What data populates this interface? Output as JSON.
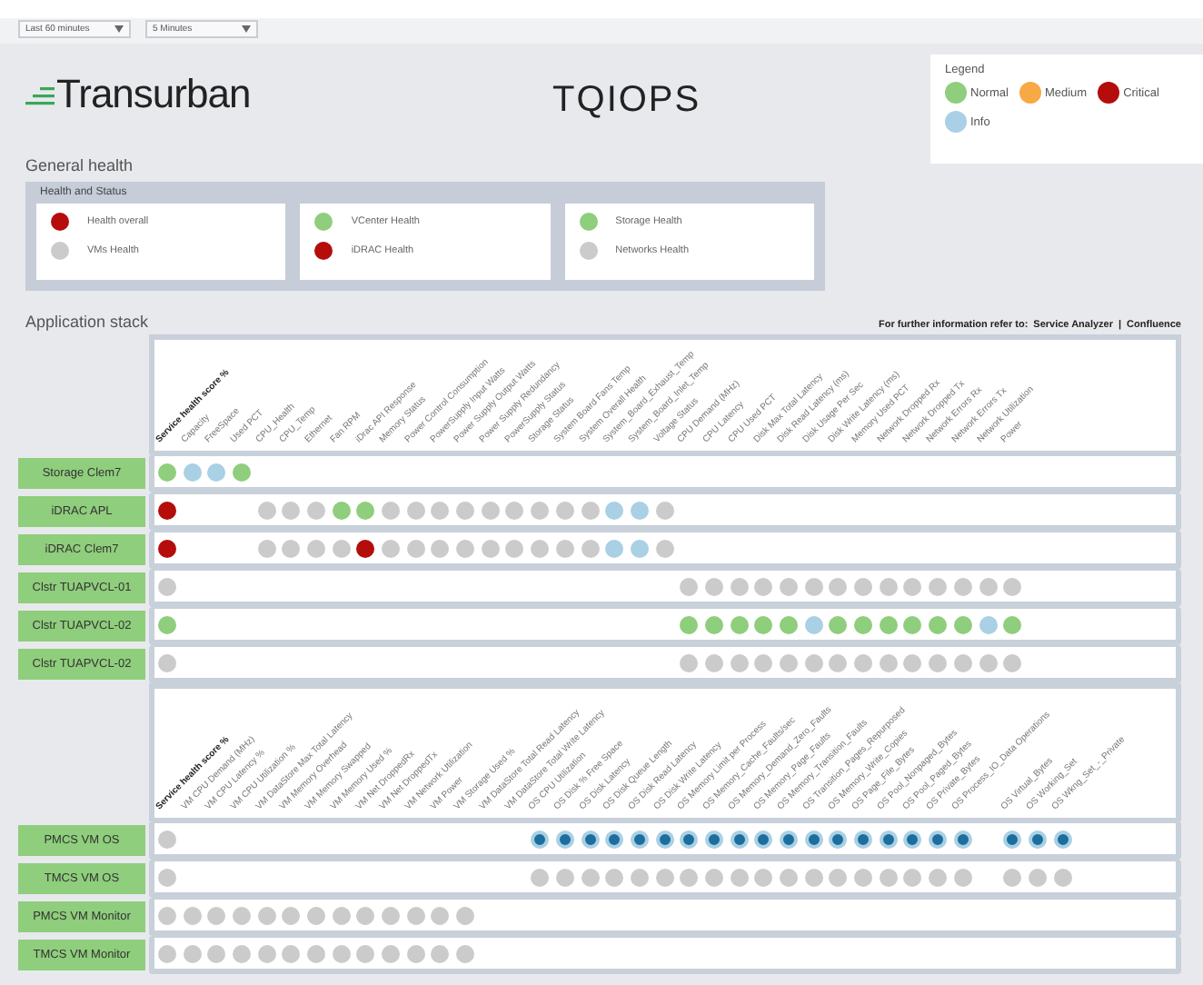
{
  "filters": [
    {
      "value": "Last 60 minutes"
    },
    {
      "value": "5 Minutes"
    }
  ],
  "header": {
    "logo": "Transurban",
    "title": "TQIOPS"
  },
  "legend": {
    "title": "Legend",
    "items": [
      {
        "label": "Normal",
        "color": "#8fce7c"
      },
      {
        "label": "Medium",
        "color": "#f6a945"
      },
      {
        "label": "Critical",
        "color": "#b50c0c"
      },
      {
        "label": "Info",
        "color": "#a9d0e4"
      }
    ]
  },
  "general_health": {
    "title": "General health",
    "panel_title": "Health and Status",
    "cards": [
      {
        "items": [
          {
            "label": "Health overall",
            "color": "#b50c0c"
          },
          {
            "label": "VMs Health",
            "color": "#cbcbcb"
          }
        ]
      },
      {
        "items": [
          {
            "label": "VCenter Health",
            "color": "#8fce7c"
          },
          {
            "label": "iDRAC Health",
            "color": "#b50c0c"
          }
        ]
      },
      {
        "items": [
          {
            "label": "Storage Health",
            "color": "#8fce7c"
          },
          {
            "label": "Networks Health",
            "color": "#cbcbcb"
          }
        ]
      }
    ]
  },
  "application_stack": {
    "title": "Application stack",
    "info_text": "For further information refer to:",
    "links": [
      "Service Analyzer",
      "Confluence"
    ],
    "separator": "|",
    "panels": [
      {
        "columns": [
          "Service health score %",
          "Capacity",
          "FreeSpace",
          "Used PCT",
          "CPU_Health",
          "CPU_Temp",
          "Ethernet",
          "Fan RPM",
          "iDrac API Response",
          "Memory Status",
          "Power Control Consumption",
          "PowerSupply Input Watts",
          "Power Supply Output Watts",
          "Power Supply Redundancy",
          "PowerSupply Status",
          "Storage Status",
          "System Board Fans Temp",
          "System Overall Health",
          "System_Board_Exhaust_Temp",
          "System_Board_Inlet_Temp",
          "Voltage Status",
          "CPU Demand (MHz)",
          "CPU Latency",
          "CPU Used PCT",
          "Disk Max Total Latency",
          "Disk Read Latency (ms)",
          "Disk Usage Per Sec",
          "Disk Write Latency (ms)",
          "Memory Used PCT",
          "Network Dropped Rx",
          "Network Dropped Tx",
          "Network Errors Rx",
          "Network Errors Tx",
          "Network Utilization",
          "Power"
        ],
        "rows": [
          {
            "label": "Storage Clem7",
            "cells": [
              {
                "color": "#8fce7c"
              },
              {
                "color": "#a9d0e4"
              },
              {
                "color": "#a9d0e4"
              },
              {
                "color": "#8fce7c"
              },
              null,
              null,
              null,
              null,
              null,
              null,
              null,
              null,
              null,
              null,
              null,
              null,
              null,
              null,
              null,
              null,
              null,
              null,
              null,
              null,
              null,
              null,
              null,
              null,
              null,
              null,
              null,
              null,
              null,
              null,
              null
            ]
          },
          {
            "label": "iDRAC APL",
            "cells": [
              {
                "color": "#b50c0c"
              },
              null,
              null,
              null,
              {
                "color": "#cbcbcb"
              },
              {
                "color": "#cbcbcb"
              },
              {
                "color": "#cbcbcb"
              },
              {
                "color": "#8fce7c"
              },
              {
                "color": "#8fce7c"
              },
              {
                "color": "#cbcbcb"
              },
              {
                "color": "#cbcbcb"
              },
              {
                "color": "#cbcbcb"
              },
              {
                "color": "#cbcbcb"
              },
              {
                "color": "#cbcbcb"
              },
              {
                "color": "#cbcbcb"
              },
              {
                "color": "#cbcbcb"
              },
              {
                "color": "#cbcbcb"
              },
              {
                "color": "#cbcbcb"
              },
              {
                "color": "#a9d0e4"
              },
              {
                "color": "#a9d0e4"
              },
              {
                "color": "#cbcbcb"
              },
              null,
              null,
              null,
              null,
              null,
              null,
              null,
              null,
              null,
              null,
              null,
              null,
              null,
              null
            ]
          },
          {
            "label": "iDRAC Clem7",
            "cells": [
              {
                "color": "#b50c0c"
              },
              null,
              null,
              null,
              {
                "color": "#cbcbcb"
              },
              {
                "color": "#cbcbcb"
              },
              {
                "color": "#cbcbcb"
              },
              {
                "color": "#cbcbcb"
              },
              {
                "color": "#b50c0c"
              },
              {
                "color": "#cbcbcb"
              },
              {
                "color": "#cbcbcb"
              },
              {
                "color": "#cbcbcb"
              },
              {
                "color": "#cbcbcb"
              },
              {
                "color": "#cbcbcb"
              },
              {
                "color": "#cbcbcb"
              },
              {
                "color": "#cbcbcb"
              },
              {
                "color": "#cbcbcb"
              },
              {
                "color": "#cbcbcb"
              },
              {
                "color": "#a9d0e4"
              },
              {
                "color": "#a9d0e4"
              },
              {
                "color": "#cbcbcb"
              },
              null,
              null,
              null,
              null,
              null,
              null,
              null,
              null,
              null,
              null,
              null,
              null,
              null,
              null
            ]
          },
          {
            "label": "Clstr TUAPVCL-01",
            "cells": [
              {
                "color": "#cbcbcb"
              },
              null,
              null,
              null,
              null,
              null,
              null,
              null,
              null,
              null,
              null,
              null,
              null,
              null,
              null,
              null,
              null,
              null,
              null,
              null,
              null,
              {
                "color": "#cbcbcb"
              },
              {
                "color": "#cbcbcb"
              },
              {
                "color": "#cbcbcb"
              },
              {
                "color": "#cbcbcb"
              },
              {
                "color": "#cbcbcb"
              },
              {
                "color": "#cbcbcb"
              },
              {
                "color": "#cbcbcb"
              },
              {
                "color": "#cbcbcb"
              },
              {
                "color": "#cbcbcb"
              },
              {
                "color": "#cbcbcb"
              },
              {
                "color": "#cbcbcb"
              },
              {
                "color": "#cbcbcb"
              },
              {
                "color": "#cbcbcb"
              },
              {
                "color": "#cbcbcb"
              }
            ]
          },
          {
            "label": "Clstr TUAPVCL-02",
            "cells": [
              {
                "color": "#8fce7c"
              },
              null,
              null,
              null,
              null,
              null,
              null,
              null,
              null,
              null,
              null,
              null,
              null,
              null,
              null,
              null,
              null,
              null,
              null,
              null,
              null,
              {
                "color": "#8fce7c"
              },
              {
                "color": "#8fce7c"
              },
              {
                "color": "#8fce7c"
              },
              {
                "color": "#8fce7c"
              },
              {
                "color": "#8fce7c"
              },
              {
                "color": "#a9d0e4"
              },
              {
                "color": "#8fce7c"
              },
              {
                "color": "#8fce7c"
              },
              {
                "color": "#8fce7c"
              },
              {
                "color": "#8fce7c"
              },
              {
                "color": "#8fce7c"
              },
              {
                "color": "#8fce7c"
              },
              {
                "color": "#a9d0e4"
              },
              {
                "color": "#8fce7c"
              }
            ]
          },
          {
            "label": "Clstr TUAPVCL-02",
            "cells": [
              {
                "color": "#cbcbcb"
              },
              null,
              null,
              null,
              null,
              null,
              null,
              null,
              null,
              null,
              null,
              null,
              null,
              null,
              null,
              null,
              null,
              null,
              null,
              null,
              null,
              {
                "color": "#cbcbcb"
              },
              {
                "color": "#cbcbcb"
              },
              {
                "color": "#cbcbcb"
              },
              {
                "color": "#cbcbcb"
              },
              {
                "color": "#cbcbcb"
              },
              {
                "color": "#cbcbcb"
              },
              {
                "color": "#cbcbcb"
              },
              {
                "color": "#cbcbcb"
              },
              {
                "color": "#cbcbcb"
              },
              {
                "color": "#cbcbcb"
              },
              {
                "color": "#cbcbcb"
              },
              {
                "color": "#cbcbcb"
              },
              {
                "color": "#cbcbcb"
              },
              {
                "color": "#cbcbcb"
              }
            ]
          }
        ]
      },
      {
        "columns": [
          "Service health score %",
          "VM CPU Demand (MHz)",
          "VM CPU Latency %",
          "VM CPU Utilization %",
          "VM DataStore Max Total Latency",
          "VM Memory Overhead",
          "VM Memory Swapped",
          "VM Memory Used %",
          "VM Net DroppedRx",
          "VM Net DroppedTx",
          "VM Network Utilization",
          "VM Power",
          "VM Storage Used %",
          "VM DataStore Total Read Latency",
          "VM DataStore Total Write Latency",
          "OS CPU Utilization",
          "OS Disk % Free Space",
          "OS Disk Latency",
          "OS Disk Queue Length",
          "OS Disk Read Latency",
          "OS Disk Write Latency",
          "OS Memory Limit per Process",
          "OS Memory_Cache_Faults/sec",
          "OS Memory_Demand_Zero_Faults",
          "OS Memory_Page_Faults",
          "OS Memory_Transition_Faults",
          "OS Transition_Pages_Repurposed",
          "OS Memory_Write_Copies",
          "OS Page_File_Bytes",
          "OS Pool_Nonpaged_Bytes",
          "OS Pool_Paged_Bytes",
          "OS Private_Bytes",
          "OS Process_IO_Data Operations",
          null,
          "OS Virtual_Bytes",
          "OS Working_Set",
          "OS Wkng_Set_-_Private"
        ],
        "rows": [
          {
            "label": "PMCS VM OS",
            "cells": [
              {
                "color": "#cbcbcb"
              },
              null,
              null,
              null,
              null,
              null,
              null,
              null,
              null,
              null,
              null,
              null,
              null,
              null,
              null,
              {
                "color": "#1c6e9e",
                "kind": "ringed"
              },
              {
                "color": "#1c6e9e",
                "kind": "ringed"
              },
              {
                "color": "#1c6e9e",
                "kind": "ringed"
              },
              {
                "color": "#1c6e9e",
                "kind": "ringed"
              },
              {
                "color": "#1c6e9e",
                "kind": "ringed"
              },
              {
                "color": "#1c6e9e",
                "kind": "ringed"
              },
              {
                "color": "#1c6e9e",
                "kind": "ringed"
              },
              {
                "color": "#1c6e9e",
                "kind": "ringed"
              },
              {
                "color": "#1c6e9e",
                "kind": "ringed"
              },
              {
                "color": "#1c6e9e",
                "kind": "ringed"
              },
              {
                "color": "#1c6e9e",
                "kind": "ringed"
              },
              {
                "color": "#1c6e9e",
                "kind": "ringed"
              },
              {
                "color": "#1c6e9e",
                "kind": "ringed"
              },
              {
                "color": "#1c6e9e",
                "kind": "ringed"
              },
              {
                "color": "#1c6e9e",
                "kind": "ringed"
              },
              {
                "color": "#1c6e9e",
                "kind": "ringed"
              },
              {
                "color": "#1c6e9e",
                "kind": "ringed"
              },
              {
                "color": "#1c6e9e",
                "kind": "ringed"
              },
              null,
              {
                "color": "#1c6e9e",
                "kind": "ringed"
              },
              {
                "color": "#1c6e9e",
                "kind": "ringed"
              },
              {
                "color": "#1c6e9e",
                "kind": "ringed"
              }
            ]
          },
          {
            "label": "TMCS VM OS",
            "cells": [
              {
                "color": "#cbcbcb"
              },
              null,
              null,
              null,
              null,
              null,
              null,
              null,
              null,
              null,
              null,
              null,
              null,
              null,
              null,
              {
                "color": "#cbcbcb"
              },
              {
                "color": "#cbcbcb"
              },
              {
                "color": "#cbcbcb"
              },
              {
                "color": "#cbcbcb"
              },
              {
                "color": "#cbcbcb"
              },
              {
                "color": "#cbcbcb"
              },
              {
                "color": "#cbcbcb"
              },
              {
                "color": "#cbcbcb"
              },
              {
                "color": "#cbcbcb"
              },
              {
                "color": "#cbcbcb"
              },
              {
                "color": "#cbcbcb"
              },
              {
                "color": "#cbcbcb"
              },
              {
                "color": "#cbcbcb"
              },
              {
                "color": "#cbcbcb"
              },
              {
                "color": "#cbcbcb"
              },
              {
                "color": "#cbcbcb"
              },
              {
                "color": "#cbcbcb"
              },
              {
                "color": "#cbcbcb"
              },
              null,
              {
                "color": "#cbcbcb"
              },
              {
                "color": "#cbcbcb"
              },
              {
                "color": "#cbcbcb"
              }
            ]
          },
          {
            "label": "PMCS VM Monitor",
            "cells": [
              {
                "color": "#cbcbcb"
              },
              {
                "color": "#cbcbcb"
              },
              {
                "color": "#cbcbcb"
              },
              {
                "color": "#cbcbcb"
              },
              {
                "color": "#cbcbcb"
              },
              {
                "color": "#cbcbcb"
              },
              {
                "color": "#cbcbcb"
              },
              {
                "color": "#cbcbcb"
              },
              {
                "color": "#cbcbcb"
              },
              {
                "color": "#cbcbcb"
              },
              {
                "color": "#cbcbcb"
              },
              {
                "color": "#cbcbcb"
              },
              {
                "color": "#cbcbcb"
              },
              null,
              null,
              null,
              null,
              null,
              null,
              null,
              null,
              null,
              null,
              null,
              null,
              null,
              null,
              null,
              null,
              null,
              null,
              null,
              null,
              null,
              null,
              null,
              null
            ]
          },
          {
            "label": "TMCS VM Monitor",
            "cells": [
              {
                "color": "#cbcbcb"
              },
              {
                "color": "#cbcbcb"
              },
              {
                "color": "#cbcbcb"
              },
              {
                "color": "#cbcbcb"
              },
              {
                "color": "#cbcbcb"
              },
              {
                "color": "#cbcbcb"
              },
              {
                "color": "#cbcbcb"
              },
              {
                "color": "#cbcbcb"
              },
              {
                "color": "#cbcbcb"
              },
              {
                "color": "#cbcbcb"
              },
              {
                "color": "#cbcbcb"
              },
              {
                "color": "#cbcbcb"
              },
              {
                "color": "#cbcbcb"
              },
              null,
              null,
              null,
              null,
              null,
              null,
              null,
              null,
              null,
              null,
              null,
              null,
              null,
              null,
              null,
              null,
              null,
              null,
              null,
              null,
              null,
              null,
              null,
              null
            ]
          }
        ]
      }
    ]
  }
}
